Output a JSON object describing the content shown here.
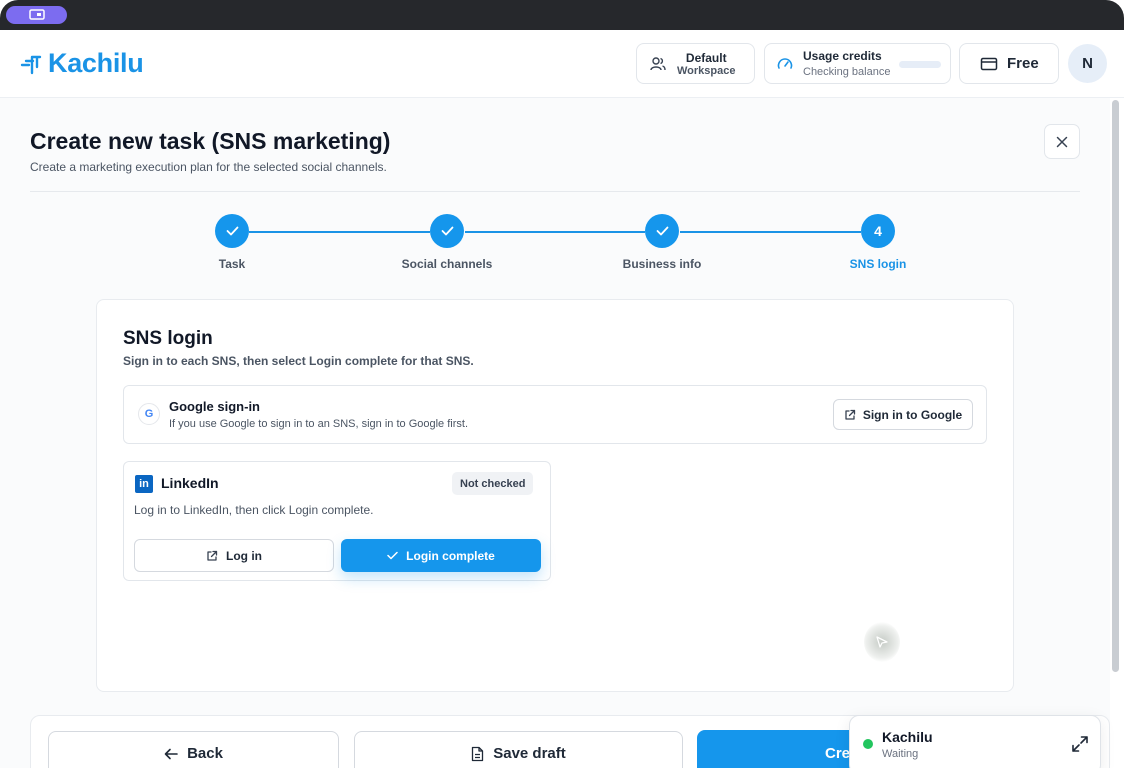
{
  "app": {
    "name": "Kachilu"
  },
  "header": {
    "workspace_line1": "Default",
    "workspace_line2": "Workspace",
    "credits_title": "Usage credits",
    "credits_status": "Checking balance",
    "plan_label": "Free",
    "avatar_initial": "N"
  },
  "page": {
    "title": "Create new task (SNS marketing)",
    "subtitle": "Create a marketing execution plan for the selected social channels."
  },
  "steps": [
    {
      "label": "Task",
      "state": "done"
    },
    {
      "label": "Social channels",
      "state": "done"
    },
    {
      "label": "Business info",
      "state": "done"
    },
    {
      "label": "SNS login",
      "number": "4",
      "state": "active"
    }
  ],
  "sns_login": {
    "title": "SNS login",
    "subtitle": "Sign in to each SNS, then select Login complete for that SNS.",
    "google": {
      "icon_letter": "G",
      "title": "Google sign-in",
      "description": "If you use Google to sign in to an SNS, sign in to Google first.",
      "button_label": "Sign in to Google"
    },
    "linkedin": {
      "icon_letters": "in",
      "name": "LinkedIn",
      "badge": "Not checked",
      "description": "Log in to LinkedIn, then click Login complete.",
      "login_label": "Log in",
      "complete_label": "Login complete"
    }
  },
  "footer": {
    "back_label": "Back",
    "draft_label": "Save draft",
    "create_label": "Cre"
  },
  "widget": {
    "name": "Kachilu",
    "status": "Waiting",
    "status_color": "#22c55e"
  },
  "colors": {
    "accent": "#1596ec",
    "brand": "#1a93e6",
    "linkedin": "#0a66c2"
  }
}
